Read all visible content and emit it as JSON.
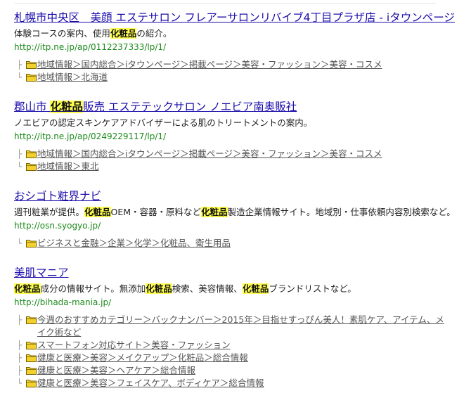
{
  "results": [
    {
      "title_parts": [
        {
          "text": "札幌市中央区　美顔 エステサロン フレアーサロンリバイブ4丁目プラザ店 - iタウンページ",
          "hl": false
        }
      ],
      "desc_parts": [
        {
          "text": "体験コースの案内、使用",
          "hl": false
        },
        {
          "text": "化粧品",
          "hl": true
        },
        {
          "text": "の紹介。",
          "hl": false
        }
      ],
      "url": "http://itp.ne.jp/ap/0112237333/lp/1/",
      "categories": [
        {
          "tree": "├",
          "label": "地域情報＞国内総合＞iタウンページ＞掲載ページ＞美容・ファッション＞美容・コスメ"
        },
        {
          "tree": "└",
          "label": "地域情報＞北海道"
        }
      ]
    },
    {
      "title_parts": [
        {
          "text": "郡山市 ",
          "hl": false
        },
        {
          "text": "化粧品",
          "hl": true
        },
        {
          "text": "販売 エステテックサロン ノエビア南奥販社",
          "hl": false
        }
      ],
      "desc_parts": [
        {
          "text": "ノエビアの認定スキンケアアドバイザーによる肌のトリートメントの案内。",
          "hl": false
        }
      ],
      "url": "http://itp.ne.jp/ap/0249229117/lp/1/",
      "categories": [
        {
          "tree": "├",
          "label": "地域情報＞国内総合＞iタウンページ＞掲載ページ＞美容・ファッション＞美容・コスメ"
        },
        {
          "tree": "└",
          "label": "地域情報＞東北"
        }
      ]
    },
    {
      "title_parts": [
        {
          "text": "おシゴト粧界ナビ",
          "hl": false
        }
      ],
      "desc_parts": [
        {
          "text": "週刊粧業が提供。",
          "hl": false
        },
        {
          "text": "化粧品",
          "hl": true
        },
        {
          "text": "OEM・容器・原料など",
          "hl": false
        },
        {
          "text": "化粧品",
          "hl": true
        },
        {
          "text": "製造企業情報サイト。地域別・仕事依頼内容別検索など。",
          "hl": false
        }
      ],
      "url": "http://osn.syogyo.jp/",
      "categories": [
        {
          "tree": "└",
          "label": "ビジネスと金融＞企業＞化学＞化粧品、衛生用品"
        }
      ]
    },
    {
      "title_parts": [
        {
          "text": "美肌マニア",
          "hl": false
        }
      ],
      "desc_parts": [
        {
          "text": "化粧品",
          "hl": true
        },
        {
          "text": "成分の情報サイト。無添加",
          "hl": false
        },
        {
          "text": "化粧品",
          "hl": true
        },
        {
          "text": "検索、美容情報、",
          "hl": false
        },
        {
          "text": "化粧品",
          "hl": true
        },
        {
          "text": "ブランドリストなど。",
          "hl": false
        }
      ],
      "url": "http://bihada-mania.jp/",
      "categories": [
        {
          "tree": "├",
          "label": "今週のおすすめカテゴリー＞バックナンバー＞2015年＞目指せすっぴん美人！素肌ケア、アイテム、メイク術など",
          "wrap": true
        },
        {
          "tree": "├",
          "label": "スマートフォン対応サイト＞美容・ファッション"
        },
        {
          "tree": "├",
          "label": "健康と医療＞美容＞メイクアップ＞化粧品＞総合情報"
        },
        {
          "tree": "├",
          "label": "健康と医療＞美容＞ヘアケア＞総合情報"
        },
        {
          "tree": "└",
          "label": "健康と医療＞美容＞フェイスケア、ボディケア＞総合情報"
        }
      ]
    }
  ],
  "colors": {
    "link": "#1a0dab",
    "url": "#1a8a1a",
    "highlight": "#ffff4f",
    "folder": "#e8c21a"
  },
  "icons": {
    "folder": "folder-icon"
  }
}
